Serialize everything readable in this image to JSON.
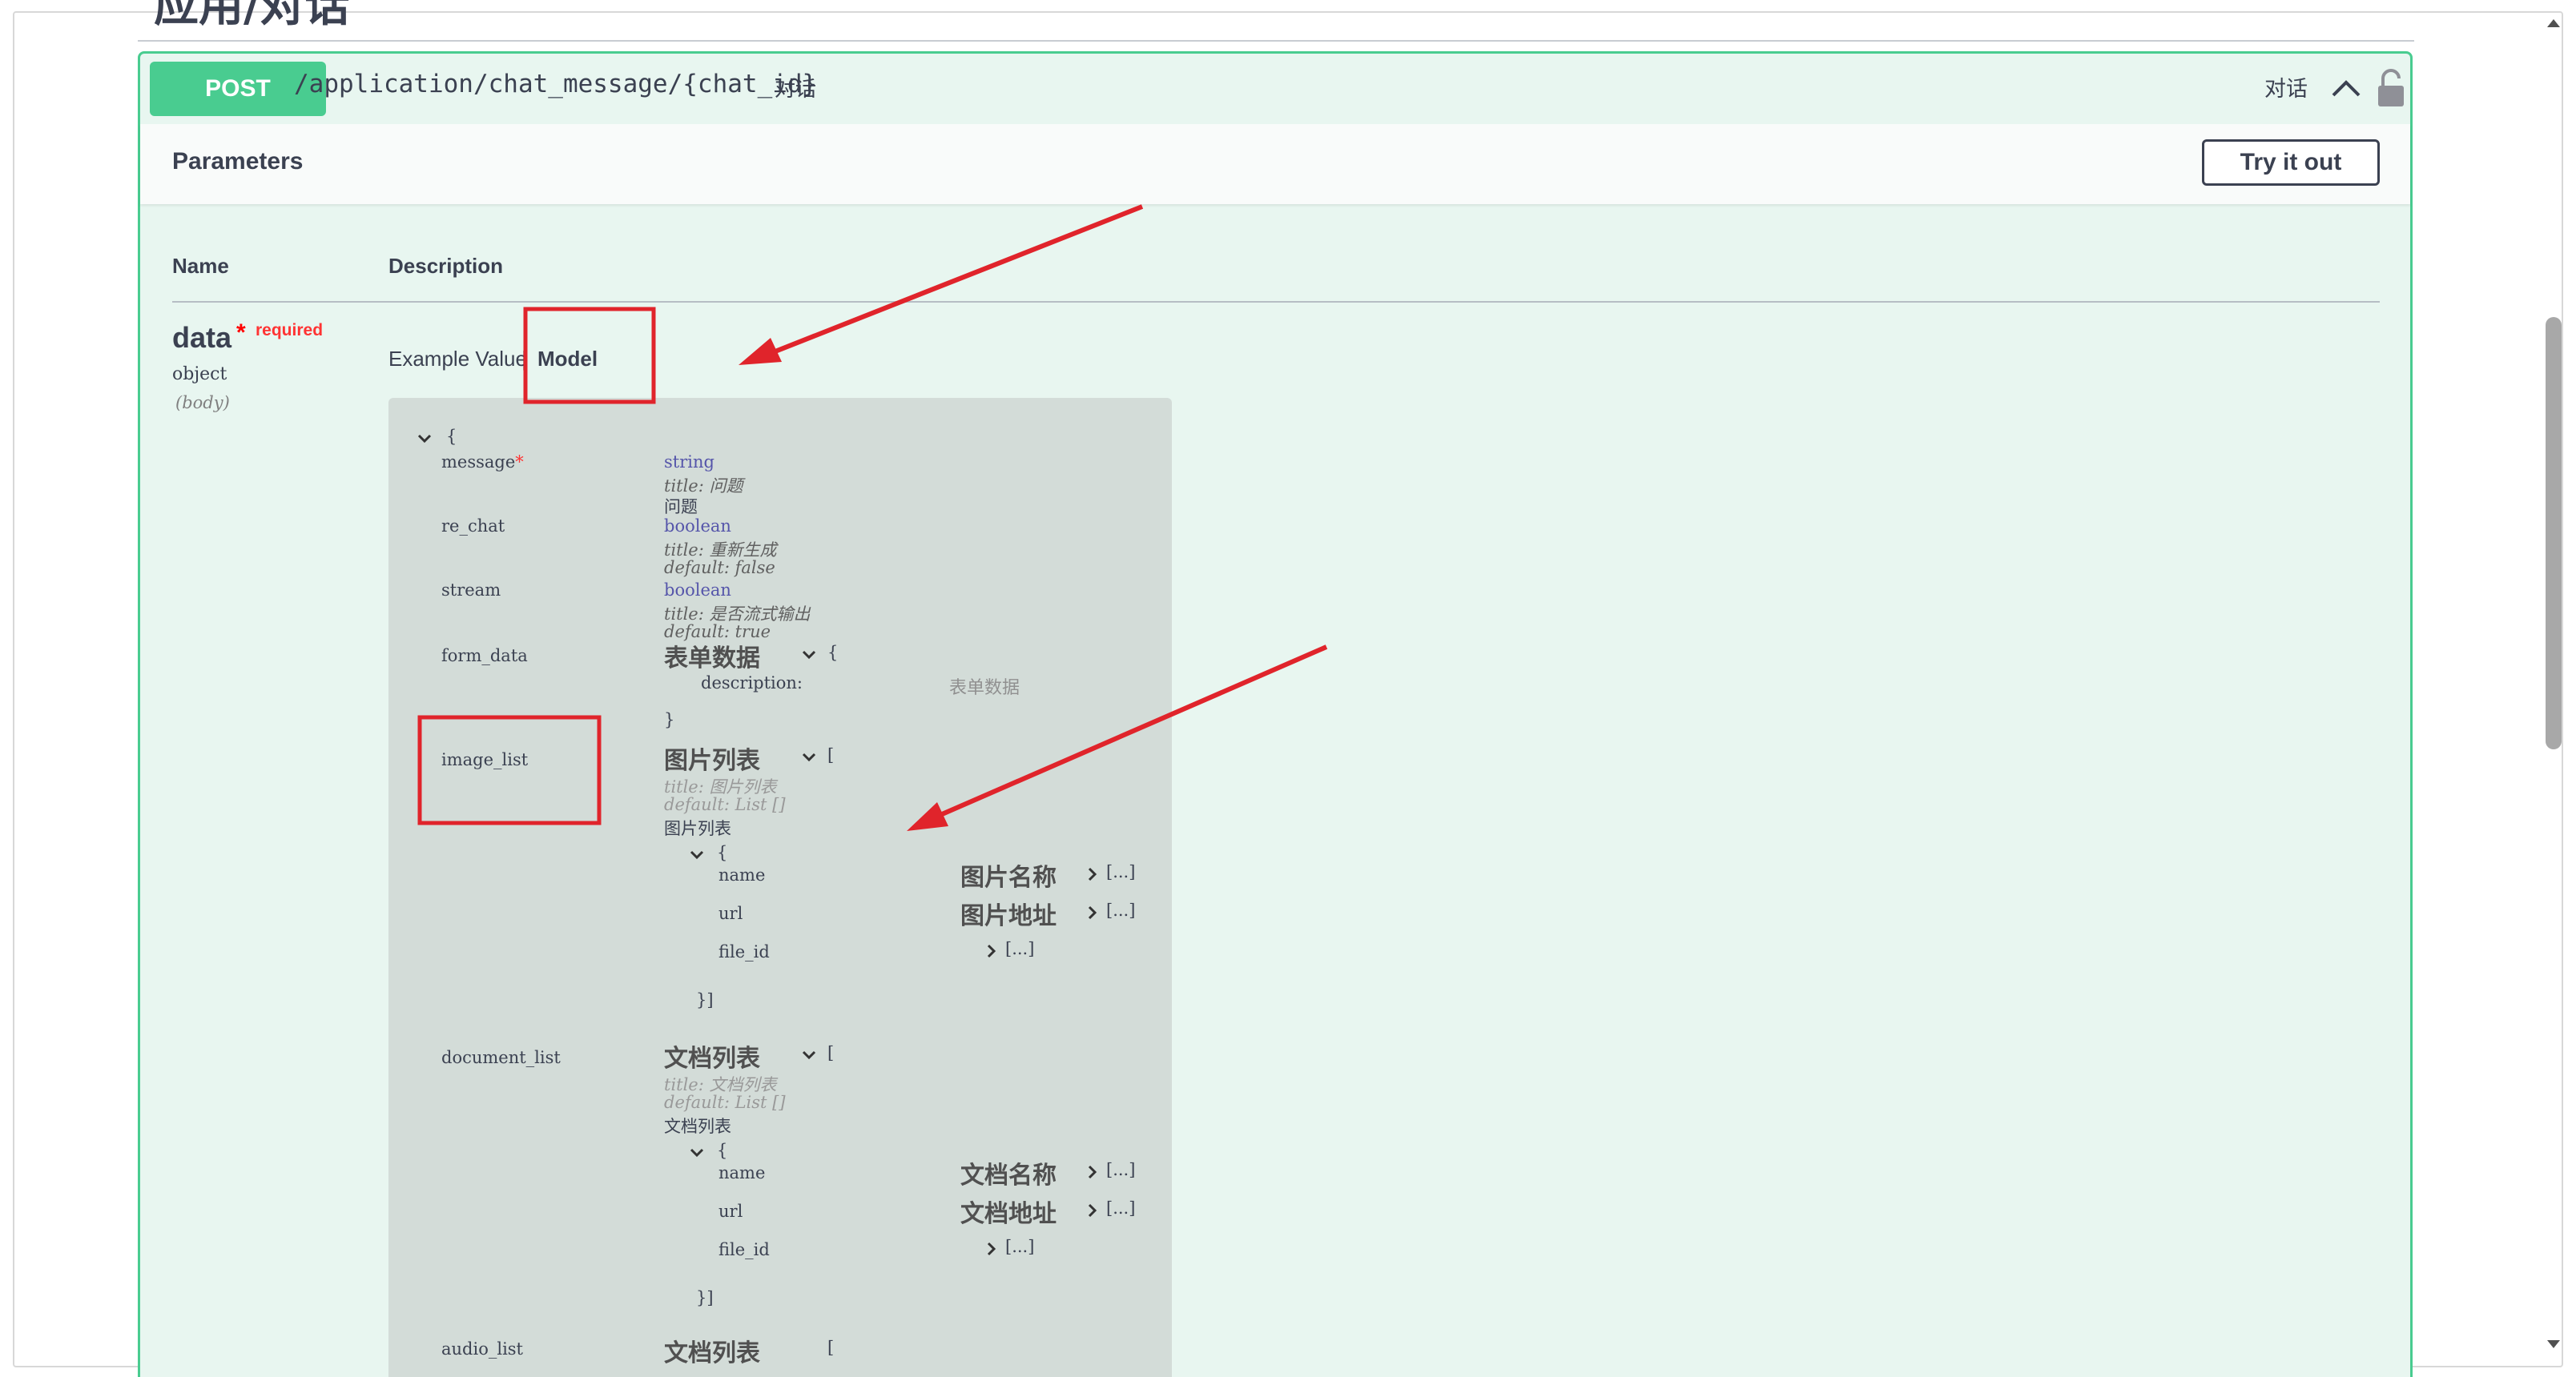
{
  "endpoint": {
    "method": "POST",
    "path": "/application/chat_message/{chat_id}",
    "summary": "对话",
    "tag": "对话"
  },
  "parameters": {
    "title": "Parameters",
    "try_button": "Try it out",
    "col_name": "Name",
    "col_description": "Description"
  },
  "param": {
    "name": "data",
    "required_star": "*",
    "required_label": "required",
    "type": "object",
    "in": "(body)"
  },
  "tabs": {
    "example": "Example Value",
    "divider": "|",
    "model": "Model"
  },
  "model": {
    "open_brace": "{",
    "message": {
      "name": "message",
      "star": "*",
      "type": "string",
      "title": "title: 问题",
      "desc": "问题"
    },
    "re_chat": {
      "name": "re_chat",
      "type": "boolean",
      "title": "title: 重新生成",
      "default": "default: false"
    },
    "stream": {
      "name": "stream",
      "type": "boolean",
      "title": "title: 是否流式输出",
      "default": "default: true"
    },
    "form_data": {
      "name": "form_data",
      "model_title": "表单数据",
      "brace": "{",
      "desc_key": "description:",
      "desc_val": "表单数据",
      "close": "}"
    },
    "image_list": {
      "name": "image_list",
      "model_title": "图片列表",
      "bracket": "[",
      "title": "title: 图片列表",
      "default": "default: List []",
      "desc": "图片列表",
      "item_brace": "{",
      "fields": [
        {
          "name": "name",
          "title": "图片名称",
          "collapsed": "[...]"
        },
        {
          "name": "url",
          "title": "图片地址",
          "collapsed": "[...]"
        },
        {
          "name": "file_id",
          "title": "",
          "collapsed": "[...]"
        }
      ],
      "close": "}]"
    },
    "document_list": {
      "name": "document_list",
      "model_title": "文档列表",
      "bracket": "[",
      "title": "title: 文档列表",
      "default": "default: List []",
      "desc": "文档列表",
      "item_brace": "{",
      "fields": [
        {
          "name": "name",
          "title": "文档名称",
          "collapsed": "[...]"
        },
        {
          "name": "url",
          "title": "文档地址",
          "collapsed": "[...]"
        },
        {
          "name": "file_id",
          "title": "",
          "collapsed": "[...]"
        }
      ],
      "close": "}]"
    },
    "audio_list": {
      "name": "audio_list",
      "model_title": "文档列表",
      "bracket": "["
    }
  },
  "annotation_color": "#e0242b",
  "accent_color": "#49cc90"
}
